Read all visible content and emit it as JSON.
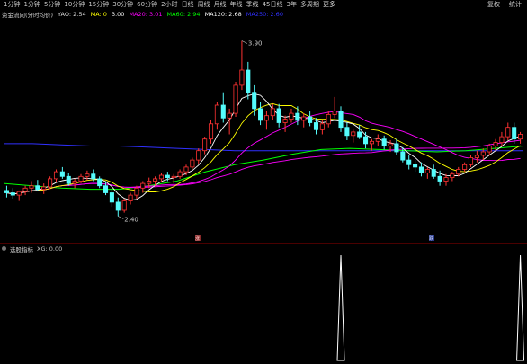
{
  "toolbar": {
    "timeframes": [
      "1分钟",
      "1分钟",
      "5分钟",
      "10分钟",
      "15分钟",
      "30分钟",
      "60分钟",
      "2小时",
      "日线",
      "周线",
      "月线",
      "年线",
      "季线",
      "45日线",
      "3年",
      "多周期",
      "更多"
    ],
    "right_items": [
      "复权",
      "统计"
    ]
  },
  "legend": {
    "title": "资金流向(分时均价)",
    "items": [
      {
        "label": "YAO: 2.54",
        "color": "#dcdcdc"
      },
      {
        "label": "MA: 0",
        "color": "#ffff00"
      },
      {
        "label": "3.00",
        "color": "#ffffff"
      },
      {
        "label": "MA20: 3.01",
        "color": "#ff00ff"
      },
      {
        "label": "MA60: 2.94",
        "color": "#00ff00"
      },
      {
        "label": "MA120: 2.68",
        "color": "#ffffff"
      },
      {
        "label": "MA250: 2.60",
        "color": "#3030ff"
      }
    ]
  },
  "markers": {
    "high_label": "3.90",
    "low_label": "2.40",
    "flag_1": "涨",
    "flag_2": "跌"
  },
  "sub_header": {
    "title": "选股指标",
    "value": "XG: 0.00"
  },
  "colors": {
    "up": "#ff3232",
    "down": "#54fcfc",
    "ma5": "#ffffff",
    "ma10": "#ffff00",
    "ma20": "#ff00ff",
    "ma60": "#00ff00",
    "ma250": "#3030ff",
    "ma120": "#e0e0a0"
  },
  "chart_data": {
    "type": "candlestick",
    "ylim": [
      2.25,
      4.05
    ],
    "grid": false,
    "candles": [
      [
        2.62,
        2.66,
        2.56,
        2.6
      ],
      [
        2.6,
        2.64,
        2.55,
        2.58
      ],
      [
        2.58,
        2.62,
        2.53,
        2.61
      ],
      [
        2.61,
        2.66,
        2.58,
        2.64
      ],
      [
        2.64,
        2.7,
        2.6,
        2.66
      ],
      [
        2.66,
        2.71,
        2.62,
        2.63
      ],
      [
        2.63,
        2.68,
        2.59,
        2.65
      ],
      [
        2.65,
        2.74,
        2.63,
        2.72
      ],
      [
        2.72,
        2.8,
        2.69,
        2.78
      ],
      [
        2.78,
        2.82,
        2.72,
        2.74
      ],
      [
        2.74,
        2.77,
        2.66,
        2.68
      ],
      [
        2.68,
        2.72,
        2.64,
        2.7
      ],
      [
        2.7,
        2.76,
        2.68,
        2.74
      ],
      [
        2.74,
        2.79,
        2.71,
        2.76
      ],
      [
        2.76,
        2.8,
        2.7,
        2.72
      ],
      [
        2.72,
        2.74,
        2.64,
        2.66
      ],
      [
        2.66,
        2.69,
        2.58,
        2.6
      ],
      [
        2.6,
        2.63,
        2.48,
        2.52
      ],
      [
        2.52,
        2.56,
        2.4,
        2.45
      ],
      [
        2.45,
        2.55,
        2.43,
        2.53
      ],
      [
        2.53,
        2.6,
        2.5,
        2.58
      ],
      [
        2.58,
        2.66,
        2.55,
        2.64
      ],
      [
        2.64,
        2.7,
        2.6,
        2.68
      ],
      [
        2.68,
        2.73,
        2.64,
        2.7
      ],
      [
        2.7,
        2.74,
        2.66,
        2.72
      ],
      [
        2.72,
        2.77,
        2.69,
        2.75
      ],
      [
        2.75,
        2.78,
        2.7,
        2.73
      ],
      [
        2.73,
        2.76,
        2.68,
        2.74
      ],
      [
        2.74,
        2.8,
        2.72,
        2.78
      ],
      [
        2.78,
        2.84,
        2.75,
        2.82
      ],
      [
        2.82,
        2.9,
        2.8,
        2.88
      ],
      [
        2.88,
        2.98,
        2.85,
        2.96
      ],
      [
        2.96,
        3.08,
        2.93,
        3.06
      ],
      [
        3.06,
        3.22,
        3.02,
        3.19
      ],
      [
        3.19,
        3.38,
        3.14,
        3.35
      ],
      [
        3.35,
        3.46,
        3.2,
        3.24
      ],
      [
        3.24,
        3.32,
        3.1,
        3.28
      ],
      [
        3.28,
        3.55,
        3.25,
        3.52
      ],
      [
        3.52,
        3.9,
        3.48,
        3.65
      ],
      [
        3.65,
        3.72,
        3.4,
        3.46
      ],
      [
        3.46,
        3.52,
        3.26,
        3.32
      ],
      [
        3.32,
        3.38,
        3.18,
        3.22
      ],
      [
        3.22,
        3.3,
        3.14,
        3.26
      ],
      [
        3.26,
        3.36,
        3.22,
        3.32
      ],
      [
        3.32,
        3.36,
        3.16,
        3.2
      ],
      [
        3.2,
        3.26,
        3.12,
        3.23
      ],
      [
        3.23,
        3.32,
        3.2,
        3.28
      ],
      [
        3.28,
        3.34,
        3.18,
        3.22
      ],
      [
        3.22,
        3.28,
        3.16,
        3.25
      ],
      [
        3.25,
        3.3,
        3.17,
        3.2
      ],
      [
        3.2,
        3.24,
        3.1,
        3.14
      ],
      [
        3.14,
        3.22,
        3.1,
        3.19
      ],
      [
        3.19,
        3.3,
        3.16,
        3.27
      ],
      [
        3.27,
        3.42,
        3.24,
        3.3
      ],
      [
        3.3,
        3.34,
        3.12,
        3.16
      ],
      [
        3.16,
        3.2,
        3.05,
        3.09
      ],
      [
        3.09,
        3.14,
        3.03,
        3.12
      ],
      [
        3.12,
        3.18,
        3.06,
        3.08
      ],
      [
        3.08,
        3.12,
        2.98,
        3.02
      ],
      [
        3.02,
        3.06,
        2.96,
        3.04
      ],
      [
        3.04,
        3.1,
        3.0,
        3.06
      ],
      [
        3.06,
        3.09,
        2.97,
        3.0
      ],
      [
        3.0,
        3.05,
        2.95,
        3.02
      ],
      [
        3.02,
        3.06,
        2.92,
        2.95
      ],
      [
        2.95,
        2.99,
        2.86,
        2.88
      ],
      [
        2.88,
        2.92,
        2.8,
        2.84
      ],
      [
        2.84,
        2.88,
        2.78,
        2.82
      ],
      [
        2.82,
        2.86,
        2.74,
        2.77
      ],
      [
        2.77,
        2.82,
        2.72,
        2.8
      ],
      [
        2.8,
        2.84,
        2.72,
        2.74
      ],
      [
        2.74,
        2.79,
        2.66,
        2.7
      ],
      [
        2.7,
        2.76,
        2.66,
        2.73
      ],
      [
        2.73,
        2.78,
        2.7,
        2.76
      ],
      [
        2.76,
        2.82,
        2.74,
        2.8
      ],
      [
        2.8,
        2.86,
        2.78,
        2.84
      ],
      [
        2.84,
        2.92,
        2.82,
        2.9
      ],
      [
        2.9,
        2.96,
        2.86,
        2.92
      ],
      [
        2.92,
        2.98,
        2.88,
        2.95
      ],
      [
        2.95,
        3.02,
        2.92,
        3.0
      ],
      [
        3.0,
        3.06,
        2.96,
        3.03
      ],
      [
        3.03,
        3.12,
        3.0,
        3.08
      ],
      [
        3.08,
        3.2,
        3.05,
        3.16
      ],
      [
        3.16,
        3.2,
        3.02,
        3.06
      ],
      [
        3.06,
        3.12,
        3.02,
        3.1
      ]
    ],
    "ma_source_periods": [
      5,
      10,
      20,
      60
    ],
    "long_lines": {
      "ma120": [
        2.68,
        2.66,
        2.64,
        2.63,
        2.63,
        2.66,
        2.7,
        2.78,
        2.84,
        2.88,
        2.93,
        2.97,
        2.98,
        2.97,
        2.96,
        2.95,
        2.96,
        2.98,
        3.0
      ],
      "ma250": [
        3.02,
        3.02,
        3.01,
        3.0,
        3.0,
        2.99,
        2.98,
        2.97,
        2.96,
        2.96,
        2.96,
        2.96,
        2.96,
        2.96,
        2.96,
        2.96,
        2.96,
        2.96,
        2.96
      ]
    },
    "indicator": {
      "values": [
        0,
        0,
        0,
        0,
        0,
        0,
        0,
        0,
        0,
        0,
        0,
        0,
        0,
        0,
        0,
        0,
        0,
        0,
        0,
        0,
        0,
        0,
        0,
        0,
        0,
        0,
        0,
        0,
        0,
        0,
        0,
        0,
        0,
        0,
        0,
        0,
        0,
        0,
        0,
        0,
        0,
        0,
        0,
        0,
        0,
        0,
        0,
        0,
        0,
        0,
        0,
        0,
        0,
        0,
        1,
        0,
        0,
        0,
        0,
        0,
        0,
        0,
        0,
        0,
        0,
        0,
        0,
        0,
        0,
        0,
        0,
        0,
        0,
        0,
        0,
        0,
        0,
        0,
        0,
        0,
        0,
        0,
        0,
        1
      ],
      "ylim": [
        0,
        1
      ]
    }
  }
}
